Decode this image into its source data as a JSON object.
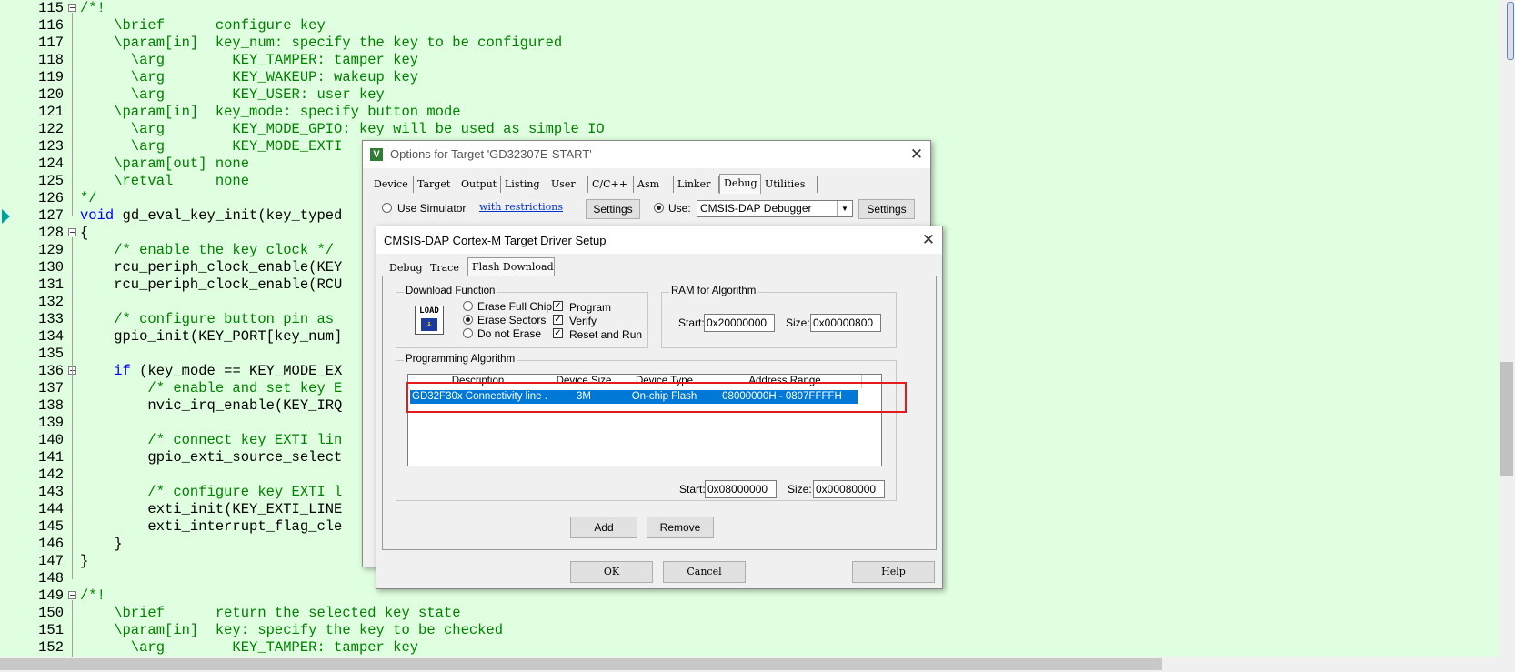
{
  "editor": {
    "lines": [
      {
        "n": "115",
        "fold": "box",
        "segs": [
          [
            "cm",
            "/*!"
          ]
        ]
      },
      {
        "n": "116",
        "segs": [
          [
            "cm",
            "    \\brief      configure key"
          ]
        ]
      },
      {
        "n": "117",
        "segs": [
          [
            "cm",
            "    \\param[in]  key_num: specify the key to be configured"
          ]
        ]
      },
      {
        "n": "118",
        "segs": [
          [
            "cm",
            "      \\arg        KEY_TAMPER: tamper key"
          ]
        ]
      },
      {
        "n": "119",
        "segs": [
          [
            "cm",
            "      \\arg        KEY_WAKEUP: wakeup key"
          ]
        ]
      },
      {
        "n": "120",
        "segs": [
          [
            "cm",
            "      \\arg        KEY_USER: user key"
          ]
        ]
      },
      {
        "n": "121",
        "segs": [
          [
            "cm",
            "    \\param[in]  key_mode: specify button mode"
          ]
        ]
      },
      {
        "n": "122",
        "segs": [
          [
            "cm",
            "      \\arg        KEY_MODE_GPIO: key will be used as simple IO"
          ]
        ]
      },
      {
        "n": "123",
        "segs": [
          [
            "cm",
            "      \\arg        KEY_MODE_EXTI"
          ]
        ]
      },
      {
        "n": "124",
        "segs": [
          [
            "cm",
            "    \\param[out] none"
          ]
        ]
      },
      {
        "n": "125",
        "segs": [
          [
            "cm",
            "    \\retval     none"
          ]
        ]
      },
      {
        "n": "126",
        "segs": [
          [
            "cm",
            "*/"
          ]
        ]
      },
      {
        "n": "127",
        "segs": [
          [
            "kw",
            "void"
          ],
          [
            "tx",
            " gd_eval_key_init(key_typed"
          ]
        ]
      },
      {
        "n": "128",
        "fold": "box",
        "segs": [
          [
            "tx",
            "{"
          ]
        ]
      },
      {
        "n": "129",
        "segs": [
          [
            "cm",
            "    /* enable the key clock */"
          ]
        ]
      },
      {
        "n": "130",
        "segs": [
          [
            "tx",
            "    rcu_periph_clock_enable(KEY"
          ]
        ]
      },
      {
        "n": "131",
        "segs": [
          [
            "tx",
            "    rcu_periph_clock_enable(RCU"
          ]
        ]
      },
      {
        "n": "132",
        "segs": [
          [
            "tx",
            ""
          ]
        ]
      },
      {
        "n": "133",
        "segs": [
          [
            "cm",
            "    /* configure button pin as "
          ]
        ]
      },
      {
        "n": "134",
        "segs": [
          [
            "tx",
            "    gpio_init(KEY_PORT[key_num]"
          ]
        ]
      },
      {
        "n": "135",
        "segs": [
          [
            "tx",
            ""
          ]
        ]
      },
      {
        "n": "136",
        "fold": "box",
        "segs": [
          [
            "tx",
            "    "
          ],
          [
            "kw",
            "if"
          ],
          [
            "tx",
            " (key_mode == KEY_MODE_EX"
          ]
        ]
      },
      {
        "n": "137",
        "segs": [
          [
            "cm",
            "        /* enable and set key E"
          ]
        ]
      },
      {
        "n": "138",
        "segs": [
          [
            "tx",
            "        nvic_irq_enable(KEY_IRQ"
          ]
        ]
      },
      {
        "n": "139",
        "segs": [
          [
            "tx",
            ""
          ]
        ]
      },
      {
        "n": "140",
        "segs": [
          [
            "cm",
            "        /* connect key EXTI lin"
          ]
        ]
      },
      {
        "n": "141",
        "segs": [
          [
            "tx",
            "        gpio_exti_source_select"
          ]
        ]
      },
      {
        "n": "142",
        "segs": [
          [
            "tx",
            ""
          ]
        ]
      },
      {
        "n": "143",
        "segs": [
          [
            "cm",
            "        /* configure key EXTI l"
          ]
        ]
      },
      {
        "n": "144",
        "segs": [
          [
            "tx",
            "        exti_init(KEY_EXTI_LINE"
          ]
        ]
      },
      {
        "n": "145",
        "segs": [
          [
            "tx",
            "        exti_interrupt_flag_cle"
          ]
        ]
      },
      {
        "n": "146",
        "segs": [
          [
            "tx",
            "    }"
          ]
        ]
      },
      {
        "n": "147",
        "segs": [
          [
            "tx",
            "}"
          ]
        ]
      },
      {
        "n": "148",
        "segs": [
          [
            "tx",
            ""
          ]
        ]
      },
      {
        "n": "149",
        "fold": "box",
        "segs": [
          [
            "cm",
            "/*!"
          ]
        ]
      },
      {
        "n": "150",
        "segs": [
          [
            "cm",
            "    \\brief      return the selected key state"
          ]
        ]
      },
      {
        "n": "151",
        "segs": [
          [
            "cm",
            "    \\param[in]  key: specify the key to be checked"
          ]
        ]
      },
      {
        "n": "152",
        "segs": [
          [
            "cm",
            "      \\arg        KEY_TAMPER: tamper key"
          ]
        ]
      }
    ]
  },
  "options_dialog": {
    "title": "Options for Target 'GD32307E-START'",
    "icon_letter": "V",
    "tabs": [
      "Device",
      "Target",
      "Output",
      "Listing",
      "User",
      "C/C++",
      "Asm",
      "Linker",
      "Debug",
      "Utilities"
    ],
    "active_tab": "Debug",
    "use_simulator_label": "Use Simulator",
    "with_restrictions_link": "with restrictions",
    "settings_label": "Settings",
    "use_label": "Use:",
    "debugger_value": "CMSIS-DAP Debugger",
    "settings2_label": "Settings"
  },
  "cmsis_dialog": {
    "title": "CMSIS-DAP Cortex-M Target Driver Setup",
    "tabs": [
      "Debug",
      "Trace",
      "Flash Download"
    ],
    "active_tab": "Flash Download",
    "download_function": {
      "group_title": "Download Function",
      "load_icon_text": "LOAD",
      "erase_full_chip": "Erase Full Chip",
      "erase_sectors": "Erase Sectors",
      "do_not_erase": "Do not Erase",
      "selected_erase": "Erase Sectors",
      "program": "Program",
      "verify": "Verify",
      "reset_and_run": "Reset and Run",
      "program_checked": true,
      "verify_checked": true,
      "reset_checked": true
    },
    "ram": {
      "group_title": "RAM for Algorithm",
      "start_label": "Start:",
      "start_value": "0x20000000",
      "size_label": "Size:",
      "size_value": "0x00000800"
    },
    "programming_algorithm": {
      "group_title": "Programming Algorithm",
      "columns": [
        "Description",
        "Device Size",
        "Device Type",
        "Address Range"
      ],
      "rows": [
        {
          "description": "GD32F30x Connectivity line ...",
          "size": "3M",
          "type": "On-chip Flash",
          "range": "08000000H - 0807FFFFH"
        }
      ],
      "start_label": "Start:",
      "start_value": "0x08000000",
      "size_label": "Size:",
      "size_value": "0x00080000"
    },
    "add_label": "Add",
    "remove_label": "Remove",
    "ok_label": "OK",
    "cancel_label": "Cancel",
    "help_label": "Help"
  },
  "colors": {
    "editor_bg": "#e0ffe0",
    "comment": "#008000",
    "keyword": "#0000ff",
    "selection": "#0078d7",
    "highlight_box": "#e41b1b"
  }
}
